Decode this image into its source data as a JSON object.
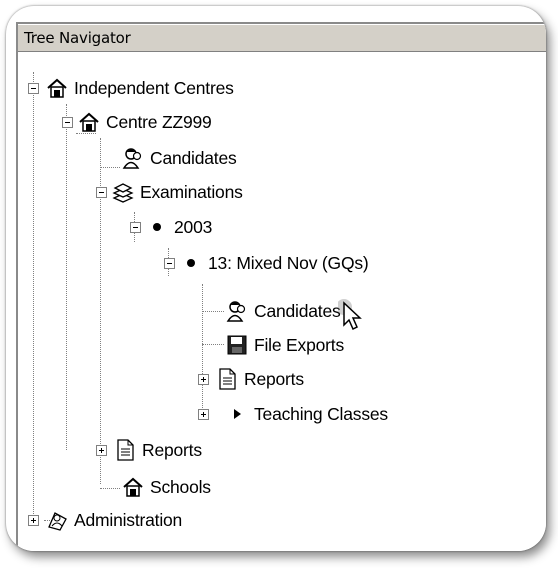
{
  "panel": {
    "title": "Tree Navigator"
  },
  "tree": {
    "independent_centres": "Independent Centres",
    "centre": "Centre ZZ999",
    "candidates": "Candidates",
    "examinations": "Examinations",
    "year": "2003",
    "series": "13: Mixed Nov (GQs)",
    "series_candidates": "Candidates",
    "file_exports": "File Exports",
    "series_reports": "Reports",
    "teaching_classes": "Teaching Classes",
    "centre_reports": "Reports",
    "schools": "Schools",
    "administration": "Administration"
  }
}
